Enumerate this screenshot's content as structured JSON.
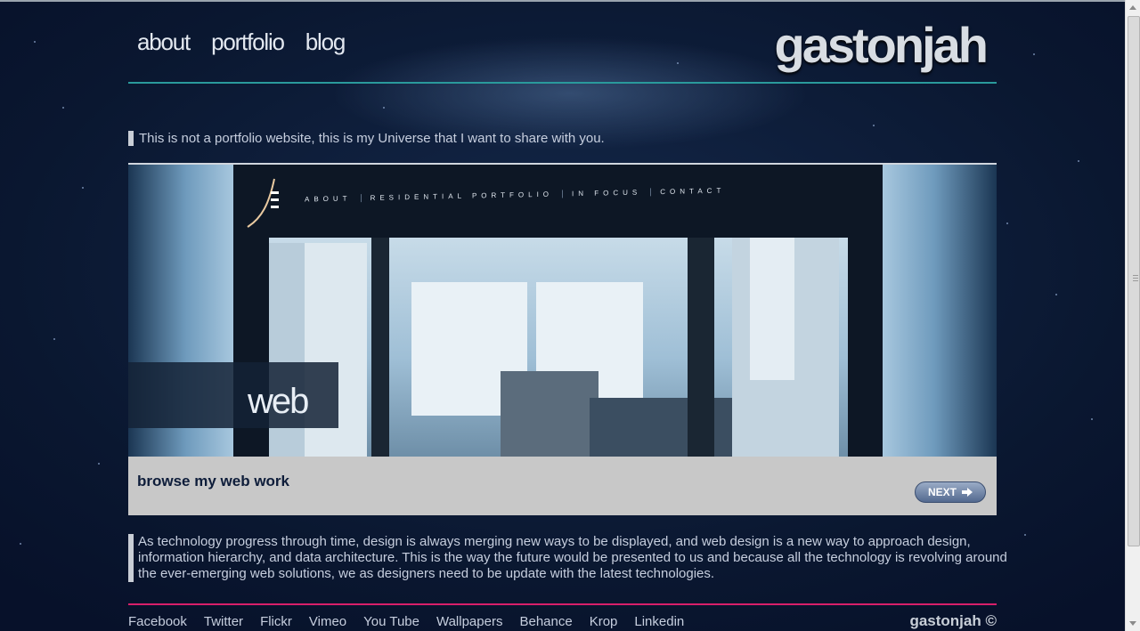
{
  "top_nav": [
    "about",
    "portfolio",
    "blog"
  ],
  "logo_text": "gastonjah",
  "tagline": "This is not a portfolio website, this is my Universe that I want to share with you.",
  "hero": {
    "site_nav": [
      "ABOUT",
      "RESIDENTIAL PORTFOLIO",
      "IN FOCUS",
      "CONTACT"
    ],
    "category_label": "web"
  },
  "browse": {
    "title": "browse my web work",
    "next_label": "NEXT",
    "next_icon": "arrow-right-icon"
  },
  "description": "As technology progress through time, design is always merging new ways to be displayed, and web design is a new way to approach design, information hierarchy, and data architecture. This is the way the future would be presented to us and because all the technology is revolving around the ever-emerging web solutions, we as designers need to be update with the latest technologies.",
  "footer": {
    "links": [
      "Facebook",
      "Twitter",
      "Flickr",
      "Vimeo",
      "You Tube",
      "Wallpapers",
      "Behance",
      "Krop",
      "Linkedin"
    ],
    "copyright": "gastonjah ©"
  },
  "colors": {
    "background": "#0b1a33",
    "teal_rule": "#2a9a9c",
    "pink_rule": "#d81f6a",
    "browse_bar": "#c8c8c8"
  }
}
